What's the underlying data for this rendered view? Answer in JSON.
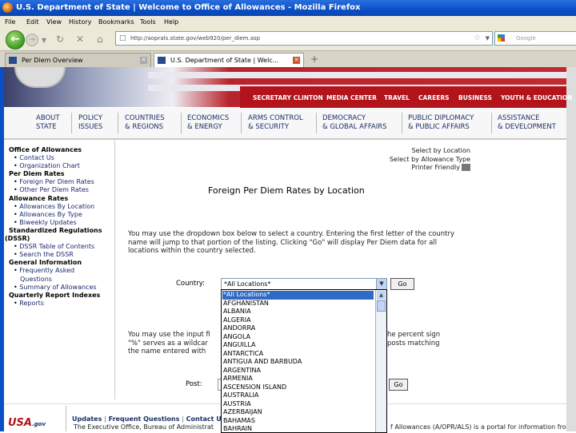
{
  "window": {
    "title": "U.S. Department of State | Welcome to Office of Allowances - Mozilla Firefox"
  },
  "menubar": [
    "File",
    "Edit",
    "View",
    "History",
    "Bookmarks",
    "Tools",
    "Help"
  ],
  "toolbar": {
    "url": "http://aoprals.state.gov/web920/per_diem.asp",
    "search_placeholder": "Google"
  },
  "tabs": [
    {
      "label": "Per Diem Overview"
    },
    {
      "label": "U.S. Department of State | Welc..."
    }
  ],
  "site": {
    "top_links": [
      "SECRETARY CLINTON",
      "MEDIA CENTER",
      "TRAVEL",
      "CAREERS",
      "BUSINESS",
      "YOUTH & EDUCATION"
    ],
    "nav": [
      {
        "l1": "ABOUT",
        "l2": "STATE"
      },
      {
        "l1": "POLICY",
        "l2": "ISSUES"
      },
      {
        "l1": "COUNTRIES",
        "l2": "& REGIONS"
      },
      {
        "l1": "ECONOMICS",
        "l2": "& ENERGY"
      },
      {
        "l1": "ARMS CONTROL",
        "l2": "& SECURITY"
      },
      {
        "l1": "DEMOCRACY",
        "l2": "& GLOBAL AFFAIRS"
      },
      {
        "l1": "PUBLIC DIPLOMACY",
        "l2": "& PUBLIC AFFAIRS"
      },
      {
        "l1": "ASSISTANCE",
        "l2": "& DEVELOPMENT"
      }
    ]
  },
  "sidebar": {
    "office": "Office of Allowances",
    "contact": "Contact Us",
    "org": "Organization Chart",
    "perdiem": "Per Diem Rates",
    "foreign": "Foreign Per Diem Rates",
    "other": "Other Per Diem Rates",
    "allow": "Allowance Rates",
    "byloc": "Allowances By Location",
    "bytype": "Allowances By Type",
    "biweekly": "Biweekly Updates",
    "dssr1": "Standardized Regulations",
    "dssr2": "(DSSR)",
    "toc": "DSSR Table of Contents",
    "search": "Search the DSSR",
    "general": "General Information",
    "faq1": "Frequently Asked",
    "faq2": "Questions",
    "summary": "Summary of Allowances",
    "quarterly": "Quarterly Report Indexes",
    "reports": "Reports"
  },
  "main": {
    "link_location": "Select by Location",
    "link_type": "Select by Allowance Type",
    "link_print": "Printer Friendly",
    "title": "Foreign Per Diem Rates by Location",
    "intro": "You may use the dropdown box below to select a country. Entering the first letter of the country name will jump to that portion of the listing. Clicking \"Go\" will display Per Diem data for all locations within the country selected.",
    "country_label": "Country:",
    "select_value": "*All Locations*",
    "go_label": "Go",
    "post_text_a": "You may use the input fi",
    "post_text_b": "he percent sign",
    "post_text_c": "\"%\" serves as a wildcar",
    "post_text_d": "posts matching",
    "post_text_e": "the name entered with",
    "post_label": "Post:",
    "go2_label": "Go"
  },
  "dropdown_options": [
    "*All Locations*",
    "AFGHANISTAN",
    "ALBANIA",
    "ALGERIA",
    "ANDORRA",
    "ANGOLA",
    "ANGUILLA",
    "ANTARCTICA",
    "ANTIGUA AND BARBUDA",
    "ARGENTINA",
    "ARMENIA",
    "ASCENSION ISLAND",
    "AUSTRALIA",
    "AUSTRIA",
    "AZERBAIJAN",
    "BAHAMAS",
    "BAHRAIN"
  ],
  "footer": {
    "updates": "Updates",
    "faq": "Frequent Questions",
    "contact": "Contact U",
    "usa": "USA",
    "gov": ".gov",
    "text_left": "The Executive Office, Bureau of Administrat",
    "text_right": "f Allowances (A/OPR/ALS) is a portal for information fro"
  }
}
